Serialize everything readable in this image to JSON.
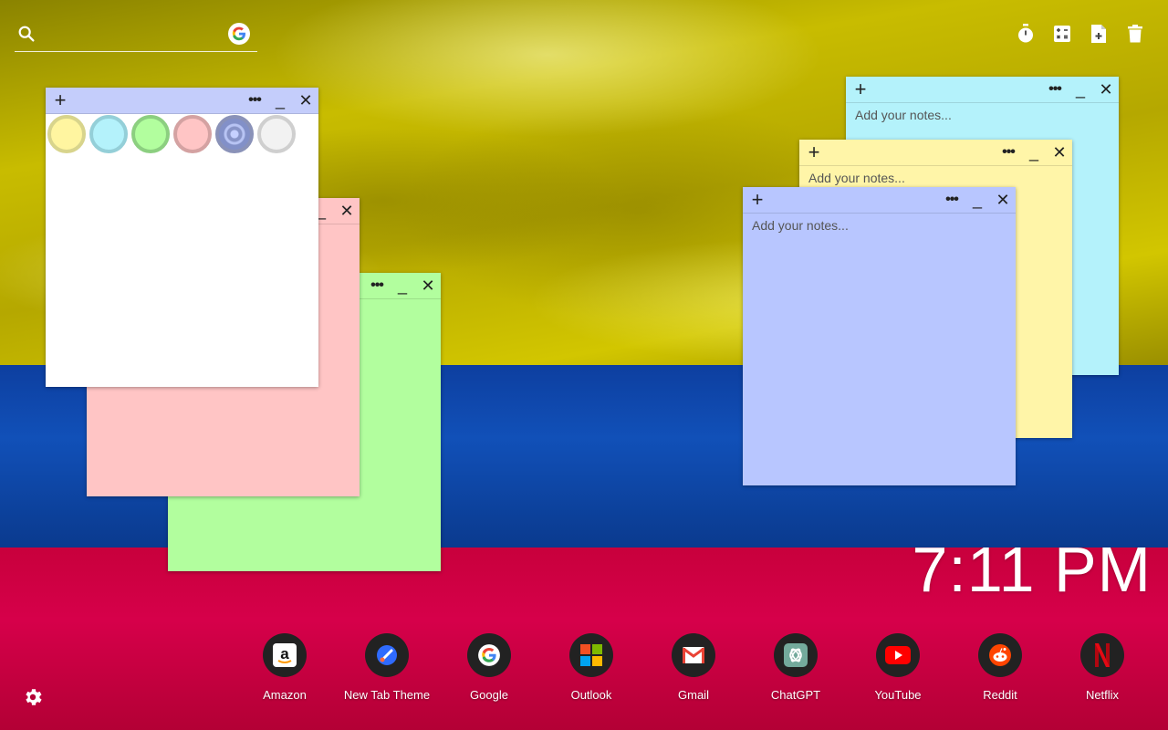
{
  "search": {
    "placeholder": "",
    "icon": "search-icon",
    "engine_icon": "google-icon"
  },
  "toolbar": [
    {
      "icon": "timer-icon"
    },
    {
      "icon": "calculator-icon"
    },
    {
      "icon": "add-note-icon"
    },
    {
      "icon": "trash-icon"
    }
  ],
  "notes": {
    "cyan": {
      "placeholder": "Add your notes...",
      "color": "#b4f2fb"
    },
    "yellow": {
      "placeholder": "Add your notes...",
      "color": "#fff5a8"
    },
    "blue": {
      "placeholder": "Add your notes...",
      "color": "#b8c6ff"
    },
    "green": {
      "color": "#b2fe9e"
    },
    "pink": {
      "color": "#ffc5c5"
    },
    "white": {
      "color": "#ffffff",
      "swatches": [
        "#fff5a0",
        "#b4f2fb",
        "#b2fe9e",
        "#ffc5c5",
        "#b8c6ff",
        "#f2f2f2"
      ]
    }
  },
  "note_buttons": {
    "add": "+",
    "menu": "•••",
    "minimize": "_",
    "close": "✕"
  },
  "clock": {
    "time": "7:11 PM"
  },
  "apps": [
    {
      "label": "Amazon",
      "icon": "amazon-icon"
    },
    {
      "label": "New Tab Theme",
      "icon": "new-tab-theme-icon"
    },
    {
      "label": "Google",
      "icon": "google-icon"
    },
    {
      "label": "Outlook",
      "icon": "outlook-icon"
    },
    {
      "label": "Gmail",
      "icon": "gmail-icon"
    },
    {
      "label": "ChatGPT",
      "icon": "chatgpt-icon"
    },
    {
      "label": "YouTube",
      "icon": "youtube-icon"
    },
    {
      "label": "Reddit",
      "icon": "reddit-icon"
    },
    {
      "label": "Netflix",
      "icon": "netflix-icon"
    }
  ],
  "settings": {
    "icon": "gear-icon"
  },
  "colors": {
    "flag_yellow": "#c8bc00",
    "flag_blue": "#1150b8",
    "flag_red": "#d6004a"
  }
}
